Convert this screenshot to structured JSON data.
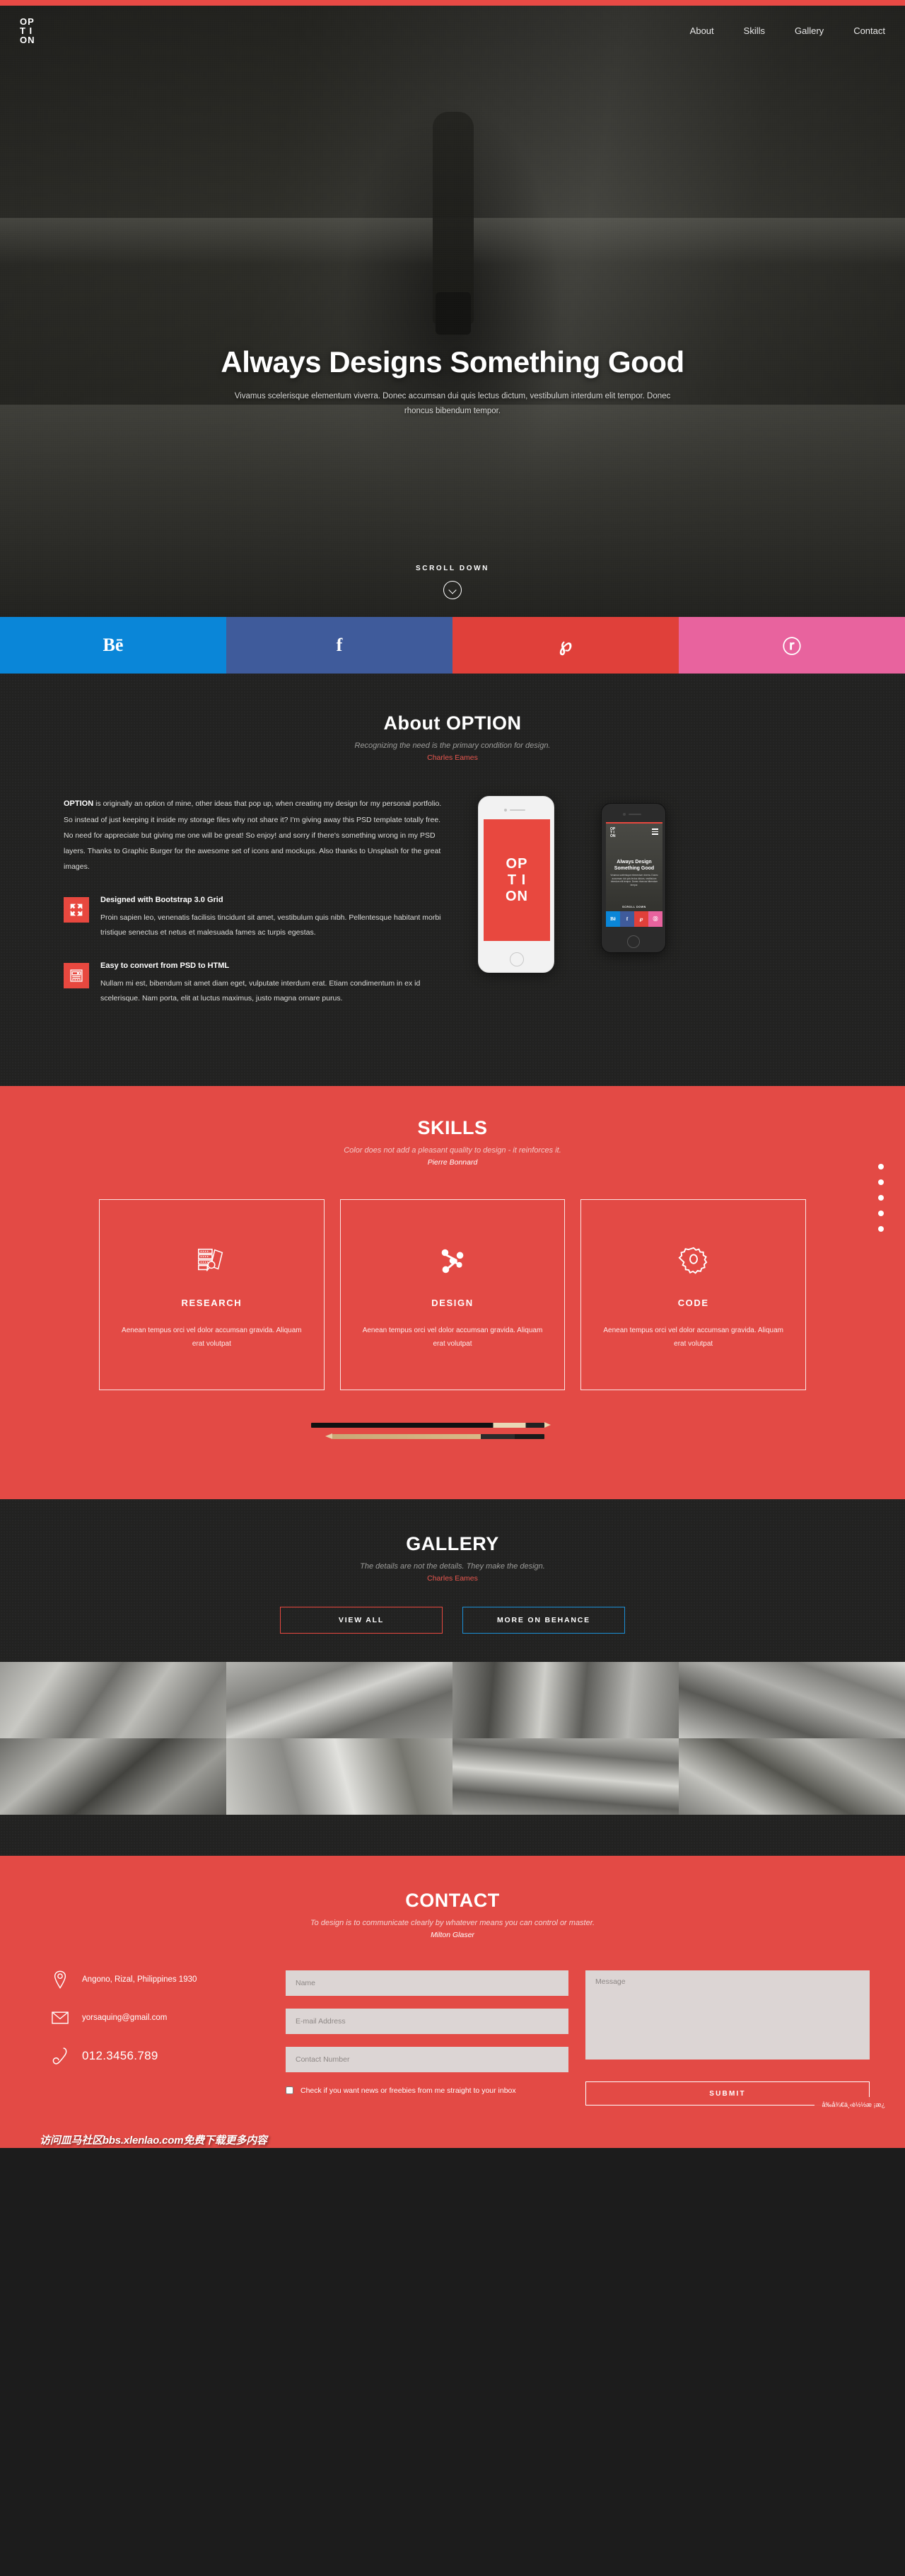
{
  "brand": {
    "logo_lines": [
      "OP",
      "T I",
      "ON"
    ],
    "accent": "#e34a45",
    "dark": "#222221"
  },
  "nav": {
    "items": [
      {
        "label": "About"
      },
      {
        "label": "Skills"
      },
      {
        "label": "Gallery"
      },
      {
        "label": "Contact"
      }
    ]
  },
  "hero": {
    "title": "Always Designs Something Good",
    "subtitle": "Vivamus scelerisque elementum viverra. Donec accumsan dui quis lectus dictum, vestibulum interdum elit tempor. Donec rhoncus bibendum tempor.",
    "scroll_label": "SCROLL DOWN"
  },
  "social": [
    {
      "name": "behance",
      "glyph": "Bē",
      "color": "#0a86d8"
    },
    {
      "name": "facebook",
      "glyph": "f",
      "color": "#3f5b9b"
    },
    {
      "name": "pinterest",
      "glyph": "℘",
      "color": "#e0403a"
    },
    {
      "name": "dribbble",
      "glyph": "ⓡ",
      "color": "#e8639e"
    }
  ],
  "about": {
    "title": "About OPTION",
    "quote": "Recognizing the need is the primary condition for design.",
    "author": "Charles Eames",
    "lead_bold": "OPTION",
    "paragraph": " is originally an option of mine, other ideas that pop up, when creating my design for my personal portfolio. So instead of just keeping it inside my storage files why not share it? I'm giving away this PSD template totally free. No need for appreciate but giving me one will be great! So enjoy! and sorry if there's something wrong in my PSD layers. Thanks to Graphic Burger for the awesome set of icons and mockups. Also thanks to Unsplash for the great images.",
    "features": [
      {
        "icon": "expand-arrows-icon",
        "title": "Designed with Bootstrap 3.0 Grid",
        "body": "Proin sapien leo, venenatis facilisis tincidunt sit amet, vestibulum quis nibh. Pellentesque habitant morbi tristique senectus et netus et malesuada fames ac turpis egestas."
      },
      {
        "icon": "layout-document-icon",
        "title": "Easy to convert from PSD to HTML",
        "body": "Nullam mi est, bibendum sit amet diam eget, vulputate interdum erat. Etiam condimentum in ex id scelerisque. Nam porta, elit at luctus maximus, justo magna ornare purus."
      }
    ],
    "phone_white_text": "OP T I ON",
    "phone_dark": {
      "title_line1": "Always Design",
      "title_line2": "Something Good",
      "para": "Vivamus scelerisque elementum viverra. Donec accumsan dui quis lectus dictum, vestibulum interdum elit tempor. Donec rhoncus bibendum tempor.",
      "scroll": "SCROLL DOWN"
    }
  },
  "skills": {
    "title": "SKILLS",
    "quote": "Color does not add a pleasant quality to design - it reinforces it.",
    "author": "Pierre Bonnard",
    "cards": [
      {
        "icon": "books-research-icon",
        "name": "RESEARCH",
        "desc": "Aenean tempus orci vel dolor accumsan gravida. Aliquam erat volutpat"
      },
      {
        "icon": "molecule-design-icon",
        "name": "DESIGN",
        "desc": "Aenean tempus orci vel dolor accumsan gravida. Aliquam erat volutpat"
      },
      {
        "icon": "gear-code-icon",
        "name": "CODE",
        "desc": "Aenean tempus orci vel dolor accumsan gravida. Aliquam erat volutpat"
      }
    ]
  },
  "gallery": {
    "title": "GALLERY",
    "quote": "The details are not the details. They make the design.",
    "author": "Charles Eames",
    "buttons": [
      {
        "label": "VIEW ALL",
        "style": "red"
      },
      {
        "label": "MORE ON BEHANCE",
        "style": "blue"
      }
    ],
    "thumbs": [
      "paint-brushes",
      "notebook-pencils",
      "tools-flatlay",
      "plants-scissors",
      "vintage-camera",
      "dont-just-stand-there-poster",
      "speaker-headphones",
      "drafting-compass"
    ]
  },
  "contact": {
    "title": "CONTACT",
    "quote": "To design is to communicate clearly by whatever means you can control or master.",
    "author": "Milton Glaser",
    "address": "Angono, Rizal, Philippines 1930",
    "email": "yorsaquing@gmail.com",
    "phone": "012.3456.789",
    "form": {
      "name_placeholder": "Name",
      "email_placeholder": "E-mail Address",
      "contact_placeholder": "Contact Number",
      "message_placeholder": "Message",
      "checkbox_label": "Check if you want news or freebies from me straight to your inbox",
      "submit_label": "SUBMIT"
    }
  },
  "dot_nav": {
    "count": 5
  },
  "watermark": {
    "main": "访问皿马社区bbs.xlenlao.com免费下载更多内容",
    "corner": "å‰å¾€ä¸‹è½½æ ¡æ¿"
  }
}
